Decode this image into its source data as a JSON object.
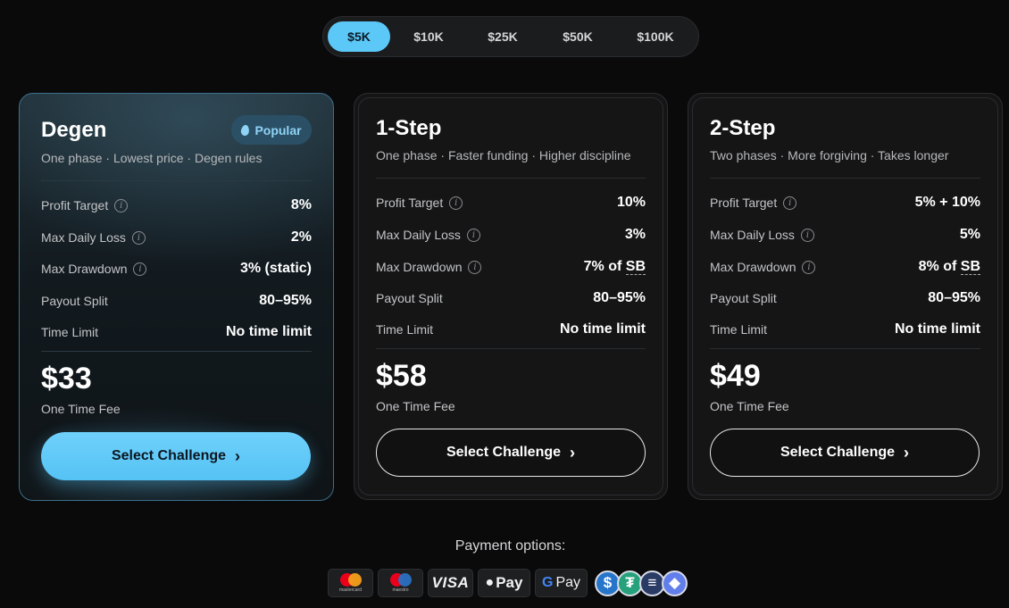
{
  "tabs": [
    {
      "label": "$5K",
      "active": true
    },
    {
      "label": "$10K",
      "active": false
    },
    {
      "label": "$25K",
      "active": false
    },
    {
      "label": "$50K",
      "active": false
    },
    {
      "label": "$100K",
      "active": false
    }
  ],
  "plans": [
    {
      "title": "Degen",
      "badge": "Popular",
      "subtitle": "One phase · Lowest price · Degen rules",
      "rows": [
        {
          "label": "Profit Target",
          "value": "8%"
        },
        {
          "label": "Max Daily Loss",
          "value": "2%"
        },
        {
          "label": "Max Drawdown",
          "value": "3% (static)"
        },
        {
          "label": "Payout Split",
          "value": "80–95%"
        },
        {
          "label": "Time Limit",
          "value": "No time limit"
        }
      ],
      "price": "$33",
      "fee_label": "One Time Fee",
      "button_label": "Select Challenge"
    },
    {
      "title": "1-Step",
      "subtitle": "One phase · Faster funding · Higher discipline",
      "rows": [
        {
          "label": "Profit Target",
          "value": "10%"
        },
        {
          "label": "Max Daily Loss",
          "value": "3%"
        },
        {
          "label": "Max Drawdown",
          "value": "7% of",
          "value_suffix": "SB"
        },
        {
          "label": "Payout Split",
          "value": "80–95%"
        },
        {
          "label": "Time Limit",
          "value": "No time limit"
        }
      ],
      "price": "$58",
      "fee_label": "One Time Fee",
      "button_label": "Select Challenge"
    },
    {
      "title": "2-Step",
      "subtitle": "Two phases · More forgiving · Takes longer",
      "rows": [
        {
          "label": "Profit Target",
          "value": "5% + 10%"
        },
        {
          "label": "Max Daily Loss",
          "value": "5%"
        },
        {
          "label": "Max Drawdown",
          "value": "8% of",
          "value_suffix": "SB"
        },
        {
          "label": "Payout Split",
          "value": "80–95%"
        },
        {
          "label": "Time Limit",
          "value": "No time limit"
        }
      ],
      "price": "$49",
      "fee_label": "One Time Fee",
      "button_label": "Select Challenge"
    }
  ],
  "payment": {
    "title": "Payment options:",
    "methods": [
      {
        "name": "mastercard-icon",
        "text": "mastercard"
      },
      {
        "name": "maestro-icon",
        "text": "maestro"
      },
      {
        "name": "visa-icon",
        "text": "VISA"
      },
      {
        "name": "apple-pay-icon",
        "text": "Pay"
      },
      {
        "name": "google-pay-icon",
        "text": "Pay"
      },
      {
        "name": "usdc-icon",
        "text": "$"
      },
      {
        "name": "usdt-icon",
        "text": "₮"
      },
      {
        "name": "solana-icon",
        "text": "≡"
      },
      {
        "name": "ethereum-icon",
        "text": "◆"
      }
    ]
  },
  "colors": {
    "accent": "#5cc8f7",
    "background": "#0a0a0b",
    "card": "#151516",
    "featured_border": "#3d6f89"
  }
}
